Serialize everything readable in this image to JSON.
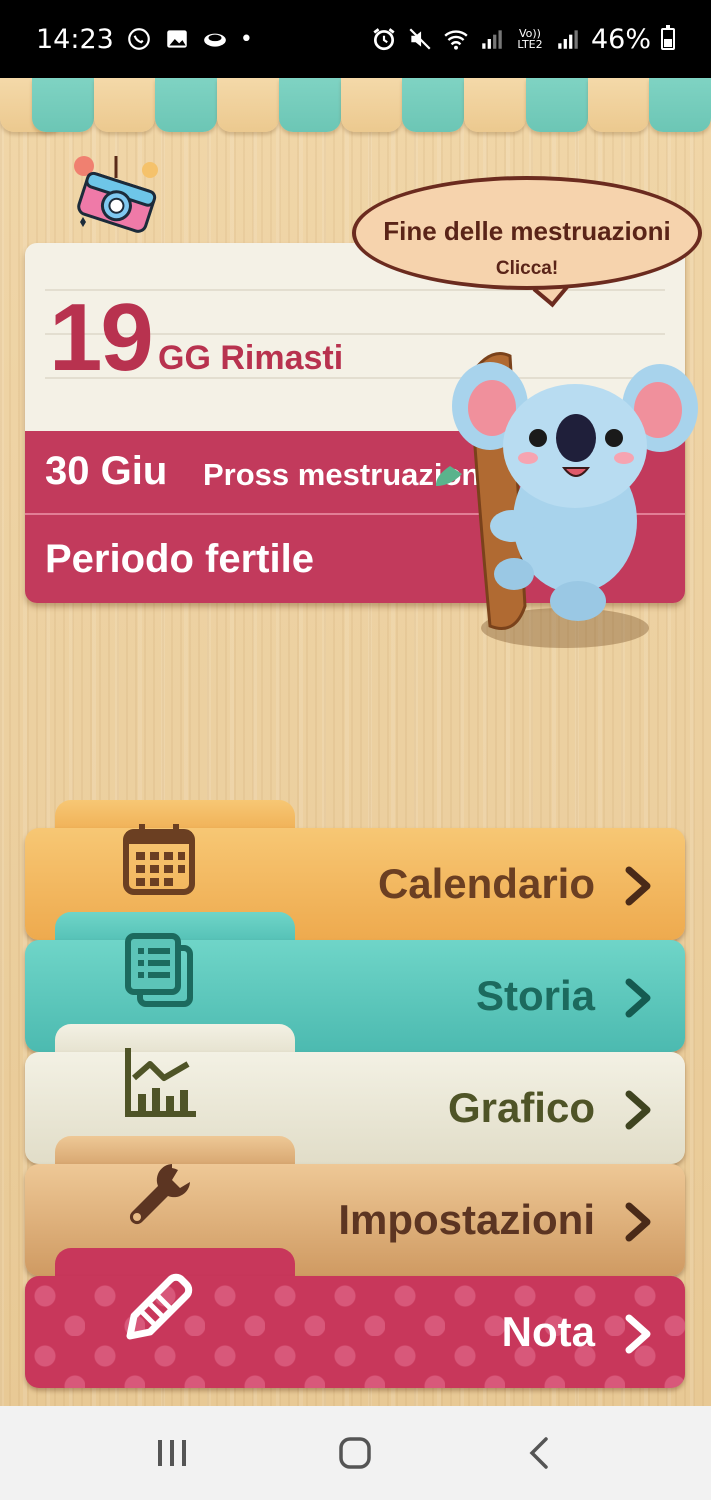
{
  "status_bar": {
    "time": "14:23",
    "battery": "46%",
    "network": "Vo)) LTE2"
  },
  "card": {
    "days_left": "19",
    "days_unit": "GG Rimasti",
    "next_date": "30 Giu",
    "next_label": "Pross mestruazioni",
    "fertile_label": "Periodo fertile"
  },
  "bubble": {
    "title": "Fine delle mestruazioni",
    "subtitle": "Clicca!"
  },
  "menu": [
    {
      "label": "Calendario",
      "icon": "calendar-icon"
    },
    {
      "label": "Storia",
      "icon": "history-icon"
    },
    {
      "label": "Grafico",
      "icon": "chart-icon"
    },
    {
      "label": "Impostazioni",
      "icon": "wrench-icon"
    },
    {
      "label": "Nota",
      "icon": "pencil-icon"
    }
  ],
  "colors": {
    "accent": "#c23a5c",
    "teal": "#6cc6b5",
    "wood": "#ecd0a0"
  }
}
